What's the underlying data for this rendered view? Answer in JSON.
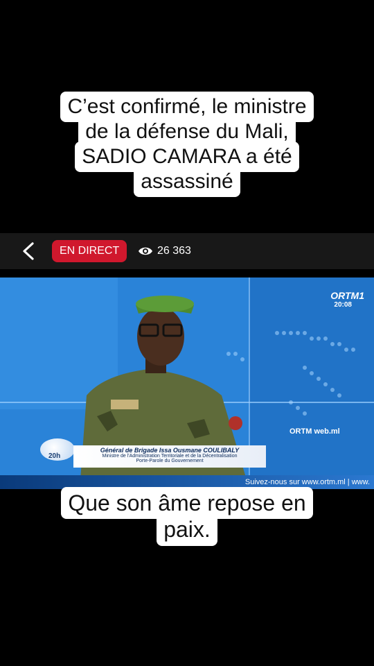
{
  "top_caption": {
    "lines": [
      "C’est confirmé, le ministre",
      "de la défense du Mali,",
      "SADIO CAMARA a été",
      "assassiné"
    ]
  },
  "live_bar": {
    "badge": "EN DIRECT",
    "viewer_count": "26 363"
  },
  "video": {
    "channel_logo": "ORTM1",
    "channel_time": "20:08",
    "lower_third": {
      "name": "Général de Brigade Issa Ousmane COULIBALY",
      "role1": "Ministre de l'Administration Territoriale et de la Décentralisation",
      "role2": "Porte-Parole du Gouvernement"
    },
    "badge_20h": "20h",
    "web_logo": "ORTM web.ml",
    "ticker": "Suivez-nous sur www.ortm.ml | www."
  },
  "bottom_caption": {
    "lines": [
      "Que son âme repose en",
      "paix."
    ]
  },
  "colors": {
    "background": "#000000",
    "live_badge": "#d0182d",
    "caption_bg": "#ffffff"
  },
  "icons": [
    "back-chevron-icon",
    "eye-icon"
  ]
}
